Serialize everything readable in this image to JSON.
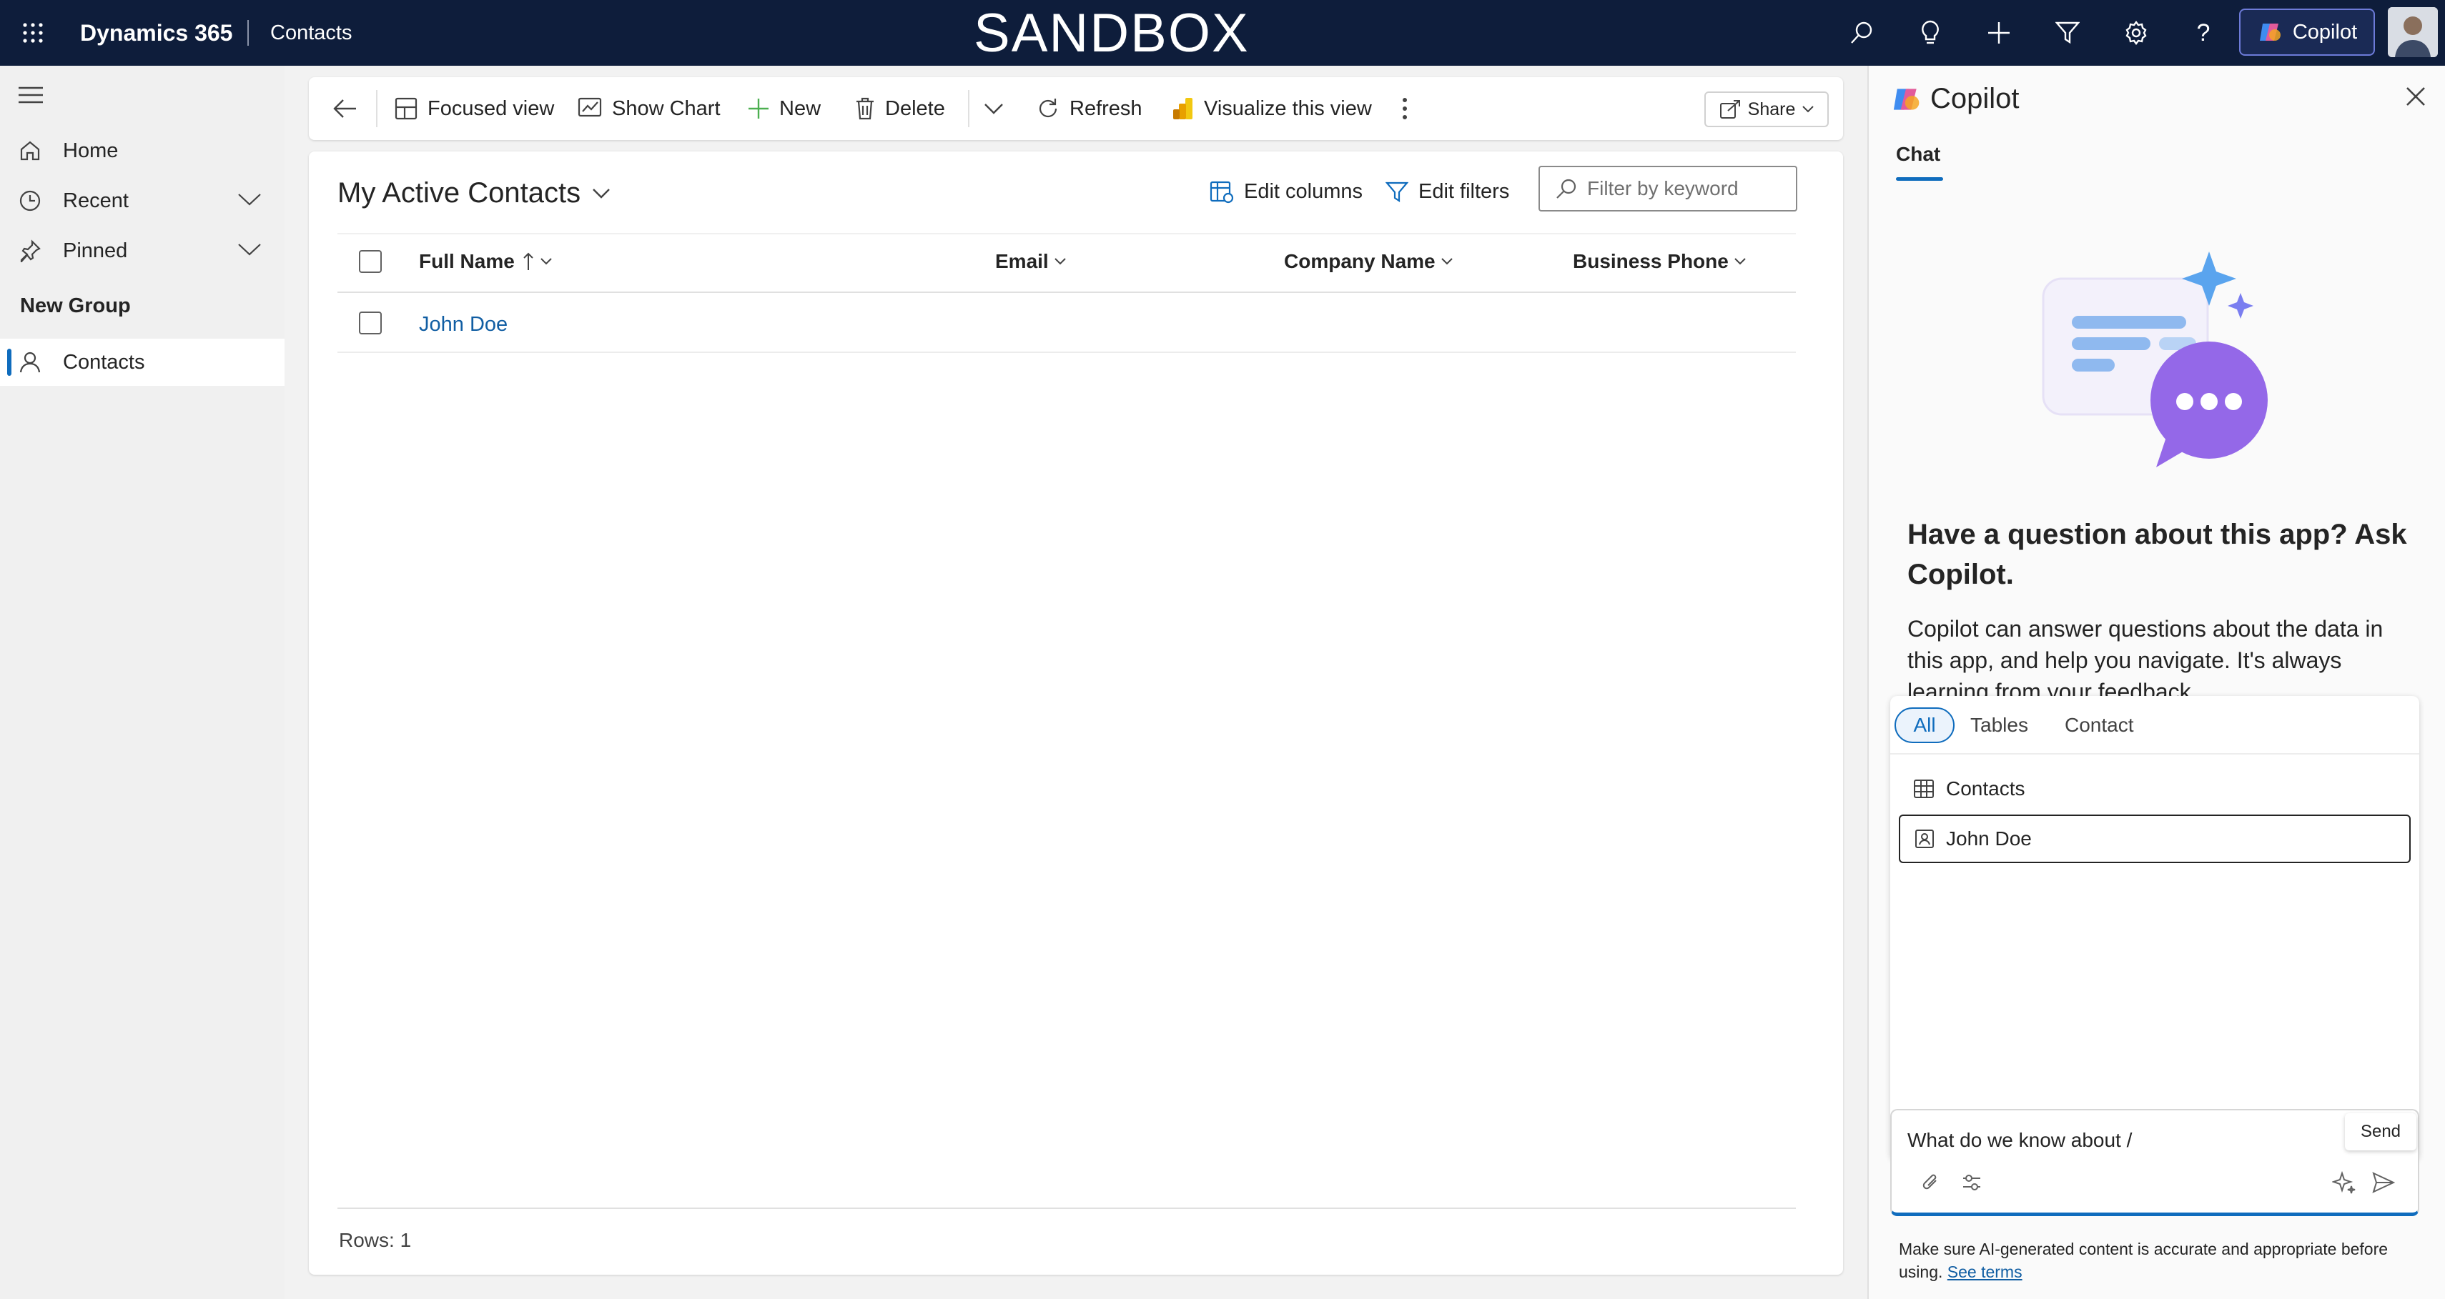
{
  "app": {
    "brand": "Dynamics 365",
    "area": "Contacts",
    "environment_label": "SANDBOX",
    "copilot_button": "Copilot"
  },
  "sidebar": {
    "items": [
      {
        "label": "Home",
        "icon": "home-icon"
      },
      {
        "label": "Recent",
        "icon": "clock-icon"
      },
      {
        "label": "Pinned",
        "icon": "pin-icon"
      }
    ],
    "group_title": "New Group",
    "group_items": [
      {
        "label": "Contacts",
        "icon": "person-icon",
        "selected": true
      }
    ]
  },
  "toolbar": {
    "focused_view": "Focused view",
    "show_chart": "Show Chart",
    "new": "New",
    "delete": "Delete",
    "refresh": "Refresh",
    "visualize": "Visualize this view",
    "share": "Share"
  },
  "view": {
    "title": "My Active Contacts",
    "edit_columns": "Edit columns",
    "edit_filters": "Edit filters",
    "filter_placeholder": "Filter by keyword",
    "columns": [
      "Full Name",
      "Email",
      "Company Name",
      "Business Phone"
    ],
    "rows": [
      {
        "full_name": "John Doe",
        "email": "",
        "company": "",
        "phone": ""
      }
    ],
    "row_count": "Rows: 1"
  },
  "copilot": {
    "title": "Copilot",
    "tab": "Chat",
    "heading": "Have a question about this app? Ask Copilot.",
    "description": "Copilot can answer questions about the data in this app, and help you navigate. It's always learning from your feedback.",
    "filter_tabs": [
      "All",
      "Tables",
      "Contact"
    ],
    "suggestions": [
      {
        "label": "Contacts",
        "icon": "table-icon"
      },
      {
        "label": "John Doe",
        "icon": "contact-card-icon"
      }
    ],
    "input_value": "What do we know about /",
    "send_tooltip": "Send",
    "disclaimer": "Make sure AI-generated content is accurate and appropriate before using.",
    "see_terms": "See terms"
  },
  "colors": {
    "topbar": "#0e1d3b",
    "accent": "#0f6cbd",
    "link": "#115ea3"
  }
}
